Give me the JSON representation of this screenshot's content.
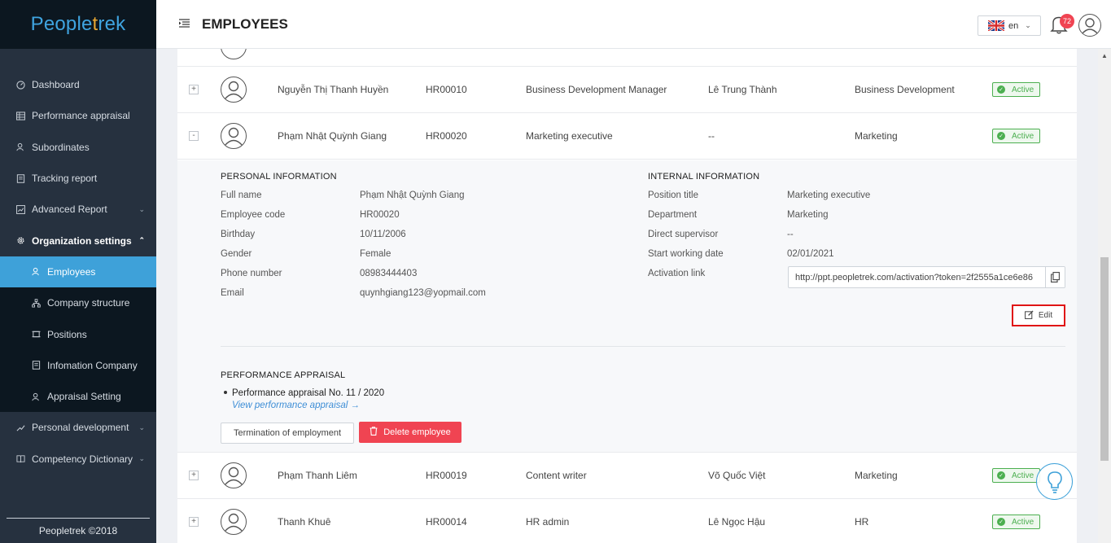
{
  "app": {
    "logo_text": "Peopletrek",
    "footer": "Peopletrek ©2018"
  },
  "sidebar": {
    "items": [
      {
        "label": "Dashboard",
        "icon": "dashboard-icon"
      },
      {
        "label": "Performance appraisal",
        "icon": "table-icon"
      },
      {
        "label": "Subordinates",
        "icon": "users-icon"
      },
      {
        "label": "Tracking report",
        "icon": "report-icon"
      },
      {
        "label": "Advanced Report",
        "icon": "chart-icon"
      },
      {
        "label": "Organization settings",
        "icon": "gear-icon"
      },
      {
        "label": "Personal development",
        "icon": "growth-icon"
      },
      {
        "label": "Competency Dictionary",
        "icon": "book-icon"
      }
    ],
    "sub_items": [
      {
        "label": "Employees",
        "icon": "users-icon"
      },
      {
        "label": "Company structure",
        "icon": "org-chart-icon"
      },
      {
        "label": "Positions",
        "icon": "positions-icon"
      },
      {
        "label": "Infomation Company",
        "icon": "info-icon"
      },
      {
        "label": "Appraisal Setting",
        "icon": "users-icon"
      }
    ]
  },
  "header": {
    "title": "EMPLOYEES",
    "language": "en",
    "notification_count": "72"
  },
  "employees": [
    {
      "name": "Nguyễn Thị Thanh Huyền",
      "code": "HR00010",
      "position": "Business Development Manager",
      "supervisor": "Lê Trung Thành",
      "department": "Business Development",
      "status": "Active",
      "expander": "+"
    },
    {
      "name": "Phạm Nhật Quỳnh Giang",
      "code": "HR00020",
      "position": "Marketing executive",
      "supervisor": "--",
      "department": "Marketing",
      "status": "Active",
      "expander": "-"
    },
    {
      "name": "Phạm Thanh Liêm",
      "code": "HR00019",
      "position": "Content writer",
      "supervisor": "Võ Quốc Việt",
      "department": "Marketing",
      "status": "Active",
      "expander": "+"
    },
    {
      "name": "Thanh Khuê",
      "code": "HR00014",
      "position": "HR admin",
      "supervisor": "Lê Ngọc Hậu",
      "department": "HR",
      "status": "Active",
      "expander": "+"
    }
  ],
  "detail": {
    "personal_title": "PERSONAL INFORMATION",
    "internal_title": "INTERNAL INFORMATION",
    "personal": [
      {
        "label": "Full name",
        "value": "Phạm Nhật Quỳnh Giang"
      },
      {
        "label": "Employee code",
        "value": "HR00020"
      },
      {
        "label": "Birthday",
        "value": "10/11/2006"
      },
      {
        "label": "Gender",
        "value": "Female"
      },
      {
        "label": "Phone number",
        "value": "08983444403"
      },
      {
        "label": "Email",
        "value": "quynhgiang123@yopmail.com"
      }
    ],
    "internal": [
      {
        "label": "Position title",
        "value": "Marketing executive"
      },
      {
        "label": "Department",
        "value": "Marketing"
      },
      {
        "label": "Direct supervisor",
        "value": "--"
      },
      {
        "label": "Start working date",
        "value": "02/01/2021"
      },
      {
        "label": "Activation link",
        "value": "http://ppt.peopletrek.com/activation?token=2f2555a1ce6e86"
      }
    ],
    "edit_label": "Edit",
    "perf_title": "PERFORMANCE APPRAISAL",
    "perf_item": "Performance appraisal No. 11 / 2020",
    "perf_link": "View performance appraisal",
    "termination_label": "Termination of employment",
    "delete_label": "Delete employee"
  },
  "colors": {
    "accent": "#3ea1d9",
    "sidebar_bg": "#26313f",
    "danger": "#f04452",
    "success": "#4caf50"
  }
}
